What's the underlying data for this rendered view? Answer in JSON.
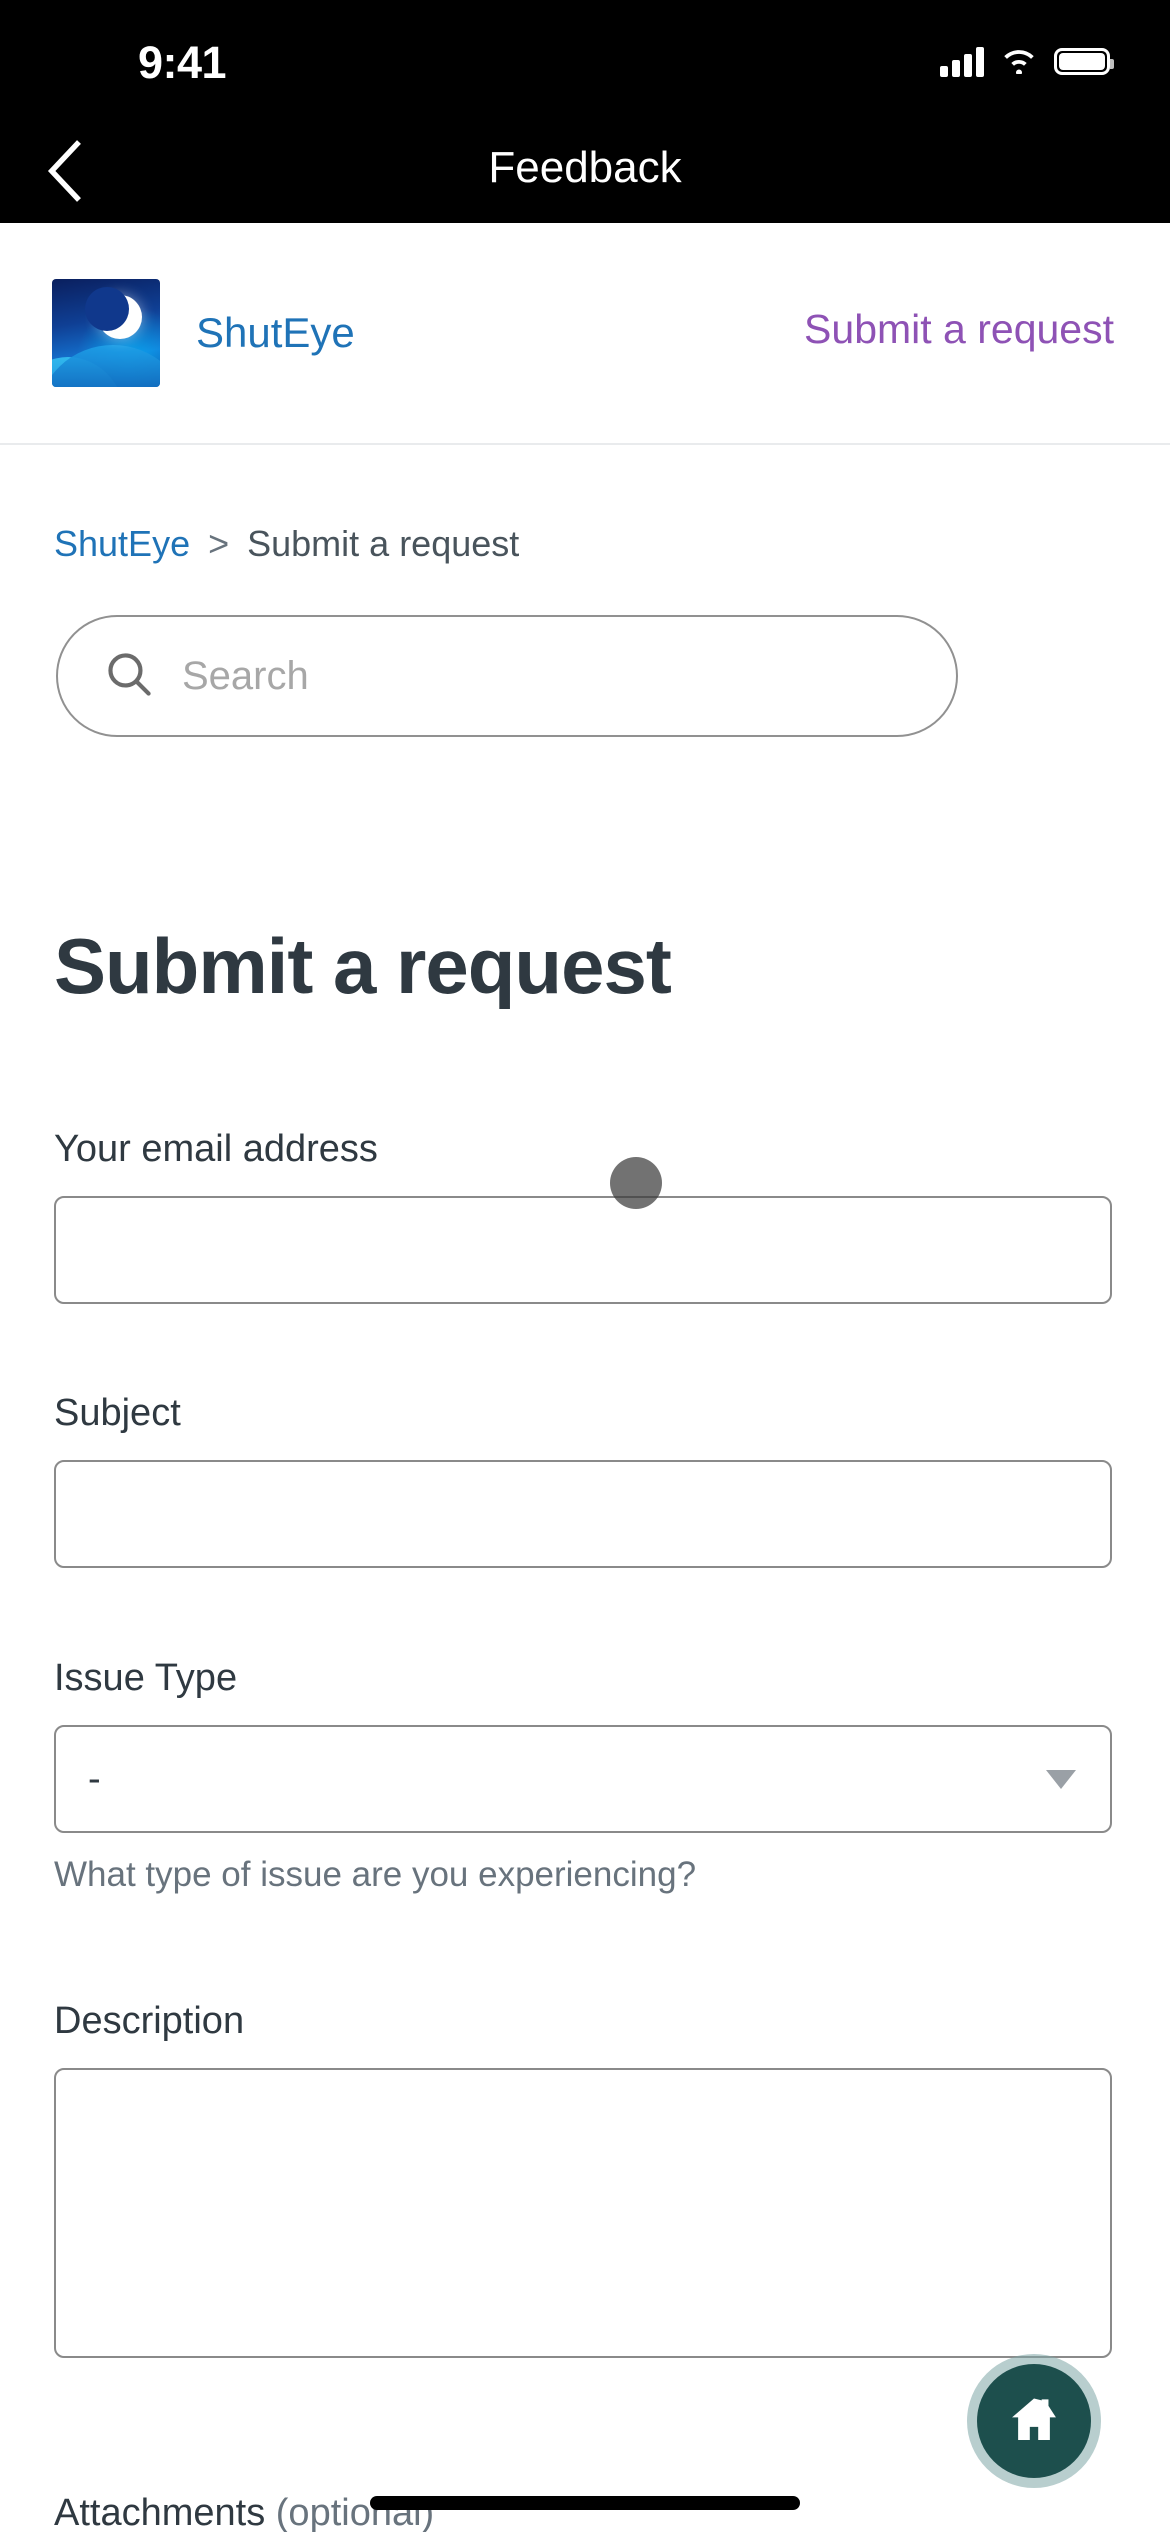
{
  "status_bar": {
    "time": "9:41",
    "icons": [
      "cellular-signal-icon",
      "wifi-icon",
      "battery-icon"
    ]
  },
  "nav_bar": {
    "back_icon": "chevron-left-icon",
    "title": "Feedback"
  },
  "brand_header": {
    "logo_icon": "shuteye-moon-logo",
    "name": "ShutEye",
    "action_link": "Submit a request",
    "name_color": "#1f73b7",
    "action_color": "#8e52b5"
  },
  "breadcrumb": {
    "root": "ShutEye",
    "separator": ">",
    "current": "Submit a request"
  },
  "search": {
    "icon": "search-icon",
    "placeholder": "Search",
    "value": ""
  },
  "page": {
    "title": "Submit a request"
  },
  "form": {
    "email": {
      "label": "Your email address",
      "value": "",
      "placeholder": ""
    },
    "subject": {
      "label": "Subject",
      "value": "",
      "placeholder": ""
    },
    "issue_type": {
      "label": "Issue Type",
      "value": "-",
      "hint": "What type of issue are you experiencing?",
      "caret_icon": "chevron-down-icon"
    },
    "description": {
      "label": "Description",
      "value": "",
      "placeholder": ""
    },
    "attachments": {
      "label": "Attachments",
      "optional_suffix": "(optional)"
    }
  },
  "floating_action": {
    "icon": "home-icon",
    "color": "#1d4f4d",
    "ring_color": "#7ea6a6"
  },
  "touch_indicator": {
    "visible": true
  },
  "home_indicator": {
    "visible": true
  }
}
